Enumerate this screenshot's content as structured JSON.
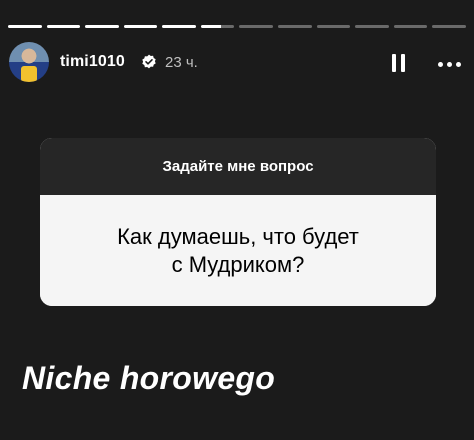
{
  "story": {
    "progress": {
      "total_segments": 12,
      "completed_segments": 5,
      "current_segment_fraction": 0.6
    },
    "user": {
      "username": "timi1010",
      "verified": true,
      "verified_icon": "verified-badge-icon",
      "time_ago": "23 ч."
    },
    "controls": {
      "pause_icon": "pause-icon",
      "more_icon": "more-options-icon"
    },
    "question_sticker": {
      "prompt": "Задайте мне вопрос",
      "question_line_1": "Как думаешь, что будет",
      "question_line_2": "с Мудриком?"
    },
    "caption": "Niche horowego"
  },
  "colors": {
    "background": "#1b1b1b",
    "sticker_header": "#262626",
    "sticker_body": "#f5f5f5",
    "text_primary": "#ffffff",
    "text_secondary": "#bfbfbf"
  }
}
